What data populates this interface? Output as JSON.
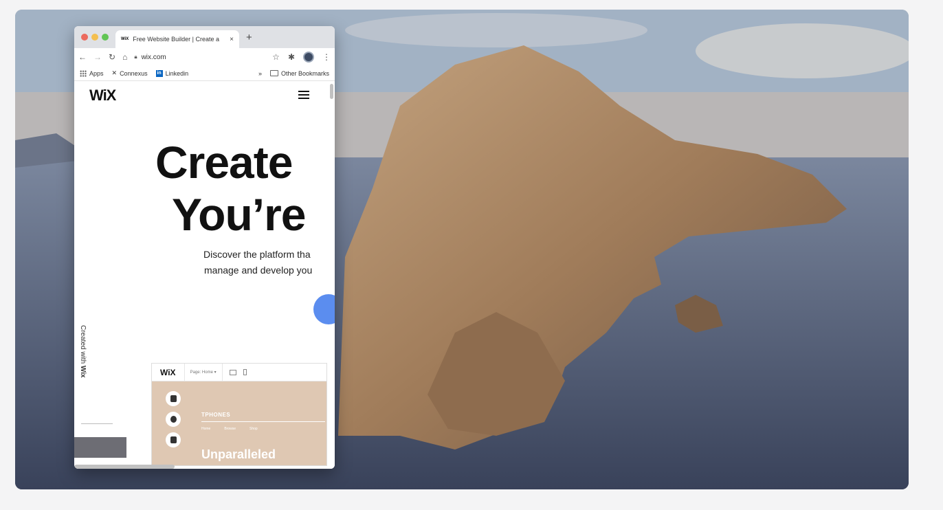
{
  "browser": {
    "tab": {
      "favicon": "WiX",
      "title": "Free Website Builder | Create a",
      "close": "×"
    },
    "new_tab": "+",
    "address": "wix.com",
    "bookmarks": {
      "apps": "Apps",
      "connexus": "Connexus",
      "linkedin": "Linkedin",
      "overflow": "»",
      "other": "Other Bookmarks"
    }
  },
  "page": {
    "logo": "WiX",
    "hero_line_1": "Create",
    "hero_line_2": "You’re",
    "sub_line_1": "Discover the platform tha",
    "sub_line_2": "manage and develop you",
    "created_with_prefix": "Created with ",
    "created_with_brand": "Wix"
  },
  "editor": {
    "logo": "WiX",
    "page_select": "Page: Home ▾",
    "brand": "TPHONES",
    "nav": [
      "Home",
      "Browse",
      "Shop"
    ],
    "headline": "Unparalleled"
  }
}
